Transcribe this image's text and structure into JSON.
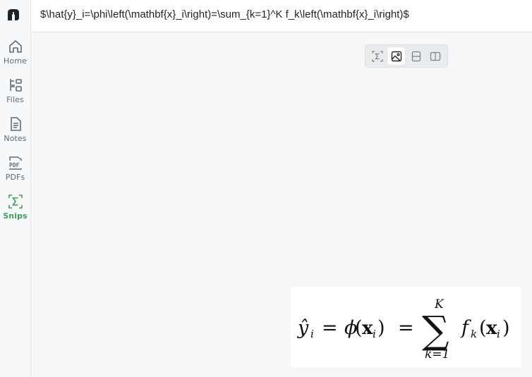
{
  "sidebar": {
    "logo": "mathpix-logo",
    "items": [
      {
        "label": "Home",
        "icon": "home-icon"
      },
      {
        "label": "Files",
        "icon": "files-icon"
      },
      {
        "label": "Notes",
        "icon": "notes-icon"
      },
      {
        "label": "PDFs",
        "icon": "pdf-icon"
      },
      {
        "label": "Snips",
        "icon": "sigma-icon",
        "active": true
      }
    ]
  },
  "header": {
    "latex": "$\\hat{y}_i=\\phi\\left(\\mathbf{x}_i\\right)=\\sum_{k=1}^K f_k\\left(\\mathbf{x}_i\\right)$"
  },
  "toolbar": {
    "buttons": [
      {
        "icon": "sigma-icon",
        "selected": false
      },
      {
        "icon": "image-icon",
        "selected": true
      },
      {
        "icon": "split-horizontal-icon",
        "selected": false
      },
      {
        "icon": "split-vertical-icon",
        "selected": false
      }
    ]
  },
  "formula": {
    "lhs_hat_y": "ŷ",
    "sub_i": "i",
    "equals": "=",
    "phi": "ϕ",
    "x_bold": "x",
    "sigma": "∑",
    "upper": "K",
    "lower": "k=1",
    "f": "f",
    "sub_k": "k"
  },
  "colors": {
    "accent": "#3a9f57",
    "muted": "#5f6b75"
  }
}
